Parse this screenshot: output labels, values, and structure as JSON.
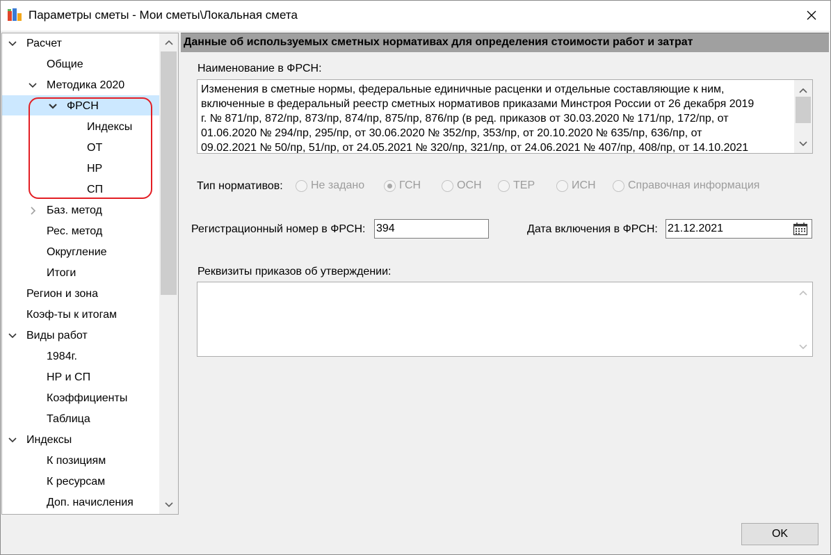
{
  "window": {
    "title": "Параметры сметы - Мои сметы\\Локальная смета"
  },
  "tree": {
    "items": [
      {
        "label": "Расчет",
        "expanded": true
      },
      {
        "label": "Общие"
      },
      {
        "label": "Методика 2020",
        "expanded": true
      },
      {
        "label": "ФРСН",
        "expanded": true,
        "selected": true
      },
      {
        "label": "Индексы"
      },
      {
        "label": "ОТ"
      },
      {
        "label": "НР"
      },
      {
        "label": "СП"
      },
      {
        "label": "Баз. метод",
        "expanded": false
      },
      {
        "label": "Рес. метод"
      },
      {
        "label": "Округление"
      },
      {
        "label": "Итоги"
      },
      {
        "label": "Регион и зона"
      },
      {
        "label": "Коэф-ты к итогам"
      },
      {
        "label": "Виды работ",
        "expanded": true
      },
      {
        "label": "1984г."
      },
      {
        "label": "НР и СП"
      },
      {
        "label": "Коэффициенты"
      },
      {
        "label": "Таблица"
      },
      {
        "label": "Индексы",
        "expanded": true
      },
      {
        "label": "К позициям"
      },
      {
        "label": "К ресурсам"
      },
      {
        "label": "Доп. начисления"
      }
    ]
  },
  "content": {
    "header": "Данные об используемых сметных нормативах для определения стоимости работ и затрат",
    "name_label": "Наименование в ФРСН:",
    "name_lines": [
      "Изменения в сметные нормы, федеральные единичные расценки и отдельные составляющие к ним,",
      "включенные в федеральный реестр сметных нормативов приказами Минстроя России от 26 декабря 2019",
      "г. № 871/пр, 872/пр, 873/пр, 874/пр, 875/пр, 876/пр (в ред. приказов от 30.03.2020 № 171/пр, 172/пр, от",
      "01.06.2020 № 294/пр, 295/пр, от 30.06.2020 № 352/пр, 353/пр, от 20.10.2020  № 635/пр, 636/пр, от",
      "09.02.2021 № 50/пр, 51/пр, от 24.05.2021 № 320/пр, 321/пр, от 24.06.2021 № 407/пр, 408/пр, от 14.10.2021"
    ],
    "type_label": "Тип нормативов:",
    "type_options": [
      "Не задано",
      "ГСН",
      "ОСН",
      "ТЕР",
      "ИСН",
      "Справочная информация"
    ],
    "type_selected": "ГСН",
    "reg_label": "Регистрационный номер в ФРСН:",
    "reg_value": "394",
    "date_label": "Дата включения в ФРСН:",
    "date_value": "21.12.2021",
    "orders_label": "Реквизиты приказов об утверждении:",
    "orders_value": ""
  },
  "footer": {
    "ok_label": "OK"
  }
}
